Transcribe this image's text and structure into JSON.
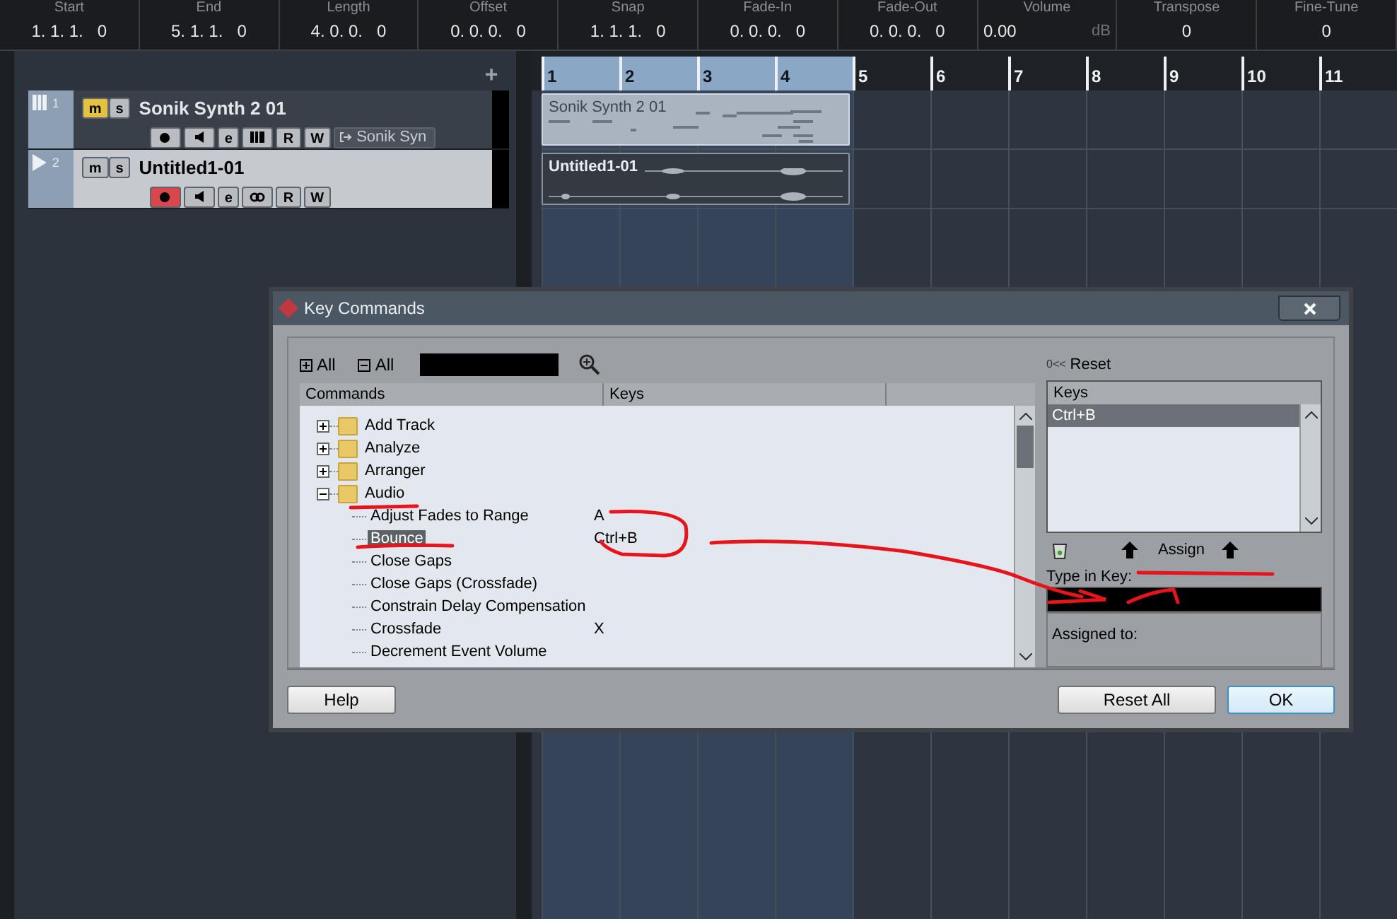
{
  "info_line": [
    {
      "label": "Start",
      "value": "1. 1. 1.   0"
    },
    {
      "label": "End",
      "value": "5. 1. 1.   0"
    },
    {
      "label": "Length",
      "value": "4. 0. 0.   0"
    },
    {
      "label": "Offset",
      "value": "0. 0. 0.   0"
    },
    {
      "label": "Snap",
      "value": "1. 1. 1.   0"
    },
    {
      "label": "Fade-In",
      "value": "0. 0. 0.   0"
    },
    {
      "label": "Fade-Out",
      "value": "0. 0. 0.   0"
    },
    {
      "label": "Volume",
      "value": "0.00",
      "unit": "dB"
    },
    {
      "label": "Transpose",
      "value": "0"
    },
    {
      "label": "Fine-Tune",
      "value": "0"
    }
  ],
  "track_list": {
    "add_button": "+",
    "tracks": [
      {
        "kind": "instrument",
        "number": "1",
        "name": "Sonik Synth 2 01",
        "selected": false,
        "mute": true,
        "solo": false,
        "record": false,
        "mute_label": "m",
        "solo_label": "s",
        "read_label": "R",
        "write_label": "W",
        "edit_label": "e",
        "output": "Sonik Syn"
      },
      {
        "kind": "audio",
        "number": "2",
        "name": "Untitled1-01",
        "selected": true,
        "mute": false,
        "solo": false,
        "record": true,
        "mute_label": "m",
        "solo_label": "s",
        "read_label": "R",
        "write_label": "W",
        "edit_label": "e"
      }
    ]
  },
  "ruler": {
    "bars": [
      {
        "label": "1",
        "in_cycle": true
      },
      {
        "label": "2",
        "in_cycle": true
      },
      {
        "label": "3",
        "in_cycle": true
      },
      {
        "label": "4",
        "in_cycle": true
      },
      {
        "label": "5",
        "in_cycle": false
      },
      {
        "label": "6",
        "in_cycle": false
      },
      {
        "label": "7",
        "in_cycle": false
      },
      {
        "label": "8",
        "in_cycle": false
      },
      {
        "label": "9",
        "in_cycle": false
      },
      {
        "label": "10",
        "in_cycle": false
      },
      {
        "label": "11",
        "in_cycle": false
      }
    ]
  },
  "events": [
    {
      "kind": "midi",
      "name": "Sonik Synth 2 01"
    },
    {
      "kind": "audio",
      "name": "Untitled1-01"
    }
  ],
  "dialog": {
    "title": "Key Commands",
    "expand_all": "All",
    "collapse_all": "All",
    "columns": [
      "Commands",
      "Keys"
    ],
    "tree": [
      {
        "label": "Add Track",
        "expanded": false
      },
      {
        "label": "Analyze",
        "expanded": false
      },
      {
        "label": "Arranger",
        "expanded": false
      },
      {
        "label": "Audio",
        "expanded": true,
        "children": [
          {
            "label": "Adjust Fades to Range",
            "keys": "A",
            "selected": false
          },
          {
            "label": "Bounce",
            "keys": "Ctrl+B",
            "selected": true
          },
          {
            "label": "Close Gaps",
            "selected": false
          },
          {
            "label": "Close Gaps (Crossfade)",
            "selected": false
          },
          {
            "label": "Constrain Delay Compensation",
            "selected": false
          },
          {
            "label": "Crossfade",
            "keys": "X",
            "selected": false
          },
          {
            "label": "Decrement Event Volume",
            "selected": false
          }
        ]
      }
    ],
    "reset_prefix": "0<<",
    "reset": "Reset",
    "keys_header": "Keys",
    "keys": [
      {
        "label": "Ctrl+B",
        "selected": true
      }
    ],
    "assign": "Assign",
    "type_in_key": "Type in Key:",
    "assigned_to": "Assigned to:",
    "buttons": {
      "help": "Help",
      "reset_all": "Reset All",
      "ok": "OK"
    }
  }
}
